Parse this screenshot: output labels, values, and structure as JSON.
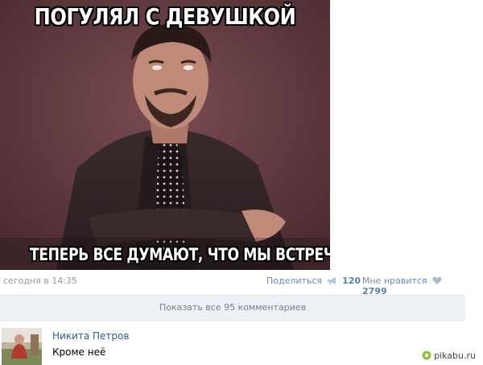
{
  "meme": {
    "caption_top": "ПОГУЛЯЛ С ДЕВУШКОЙ",
    "caption_bottom": "ТЕПЕРЬ ВСЕ ДУМАЮТ, ЧТО МЫ ВСТРЕЧАЕМСЯ"
  },
  "post": {
    "date": "сегодня в 14:35",
    "share_label": "Поделиться",
    "share_count": "120",
    "like_label": "Мне нравится",
    "like_count": "2799"
  },
  "comments_bar": {
    "label": "Показать все 95 комментариев"
  },
  "comment": {
    "author": "Никита Петров",
    "text": "Кроме неё"
  },
  "watermark": {
    "text": "pikabu.ru"
  },
  "icons": {
    "share": "megaphone-icon",
    "like": "heart-icon",
    "watermark": "pikabu-logo-icon"
  },
  "colors": {
    "link": "#6b8ab0",
    "author": "#2f5b8f",
    "bar_bg": "#edf1f5",
    "muted": "#999999"
  }
}
